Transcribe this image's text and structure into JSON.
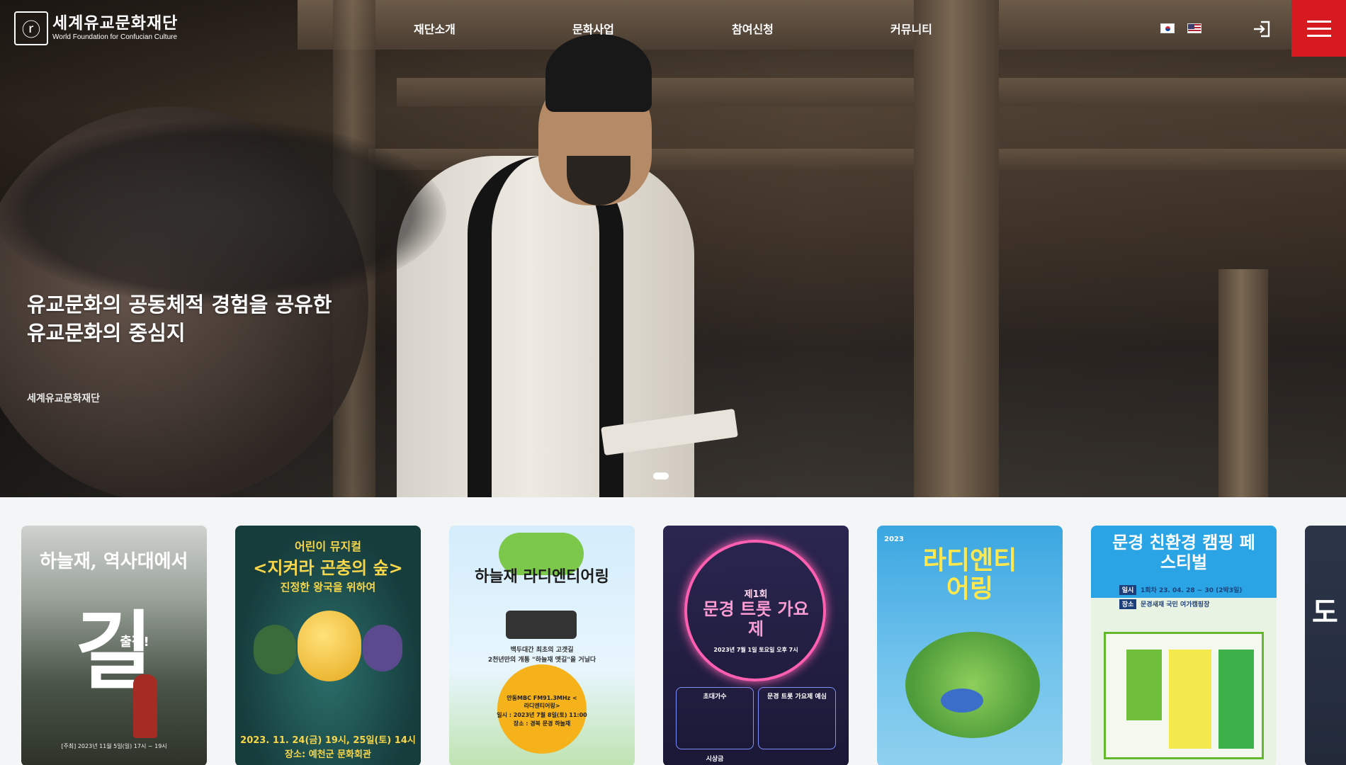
{
  "header": {
    "logo_mark": "ⓡ",
    "logo_ko": "세계유교문화재단",
    "logo_en": "World Foundation for Confucian Culture",
    "nav": [
      "재단소개",
      "문화사업",
      "참여신청",
      "커뮤니티"
    ]
  },
  "hero": {
    "title": "유교문화의 공동체적 경험을 공유한\n유교문화의 중심지",
    "subtitle": "세계유교문화재단",
    "slides": 1
  },
  "posters": [
    {
      "main": "길",
      "top": "하늘재, 역사대에서",
      "side": "출정!",
      "bottom": "[주최] 2023년 11월 5일(일) 17시 ~ 19시"
    },
    {
      "top": "어린이 뮤지컬",
      "main": "<지켜라 곤충의 숲>",
      "sub": "진정한 왕국을 위하여",
      "bottom": "2023. 11. 24(금) 19시, 25일(토) 14시",
      "venue": "장소: 예천군 문화회관"
    },
    {
      "main": "하늘재 라디엔티어링",
      "sub": "백두대간 최초의 고갯길",
      "sub2": "2천년만의 개통 \"하늘재 옛길\"을 거닐다",
      "badge": "안동MBC FM91.3MHz <라디엔티어링>",
      "date": "일시 : 2023년 7월 8일(토) 11:00",
      "venue": "장소 : 경북 문경 하늘재"
    },
    {
      "top": "제1회",
      "main": "문경 트롯 가요제",
      "date": "2023년 7월 1일 토요일 오후 7시",
      "section1": "초대가수",
      "section2": "문경 트롯 가요제 예심",
      "section3": "시상금"
    },
    {
      "top": "2023",
      "main": "라디엔티어링"
    },
    {
      "main": "문경 친환경 캠핑 페스티벌",
      "date_label": "일시",
      "date": "1회차 23. 04. 28 ~ 30 (2박3일)",
      "venue_label": "장소",
      "venue": "문경새재 국민 여가캠핑장"
    },
    {
      "main": "도"
    }
  ],
  "colors": {
    "accent": "#d71920",
    "bg": "#f3f5f7"
  }
}
